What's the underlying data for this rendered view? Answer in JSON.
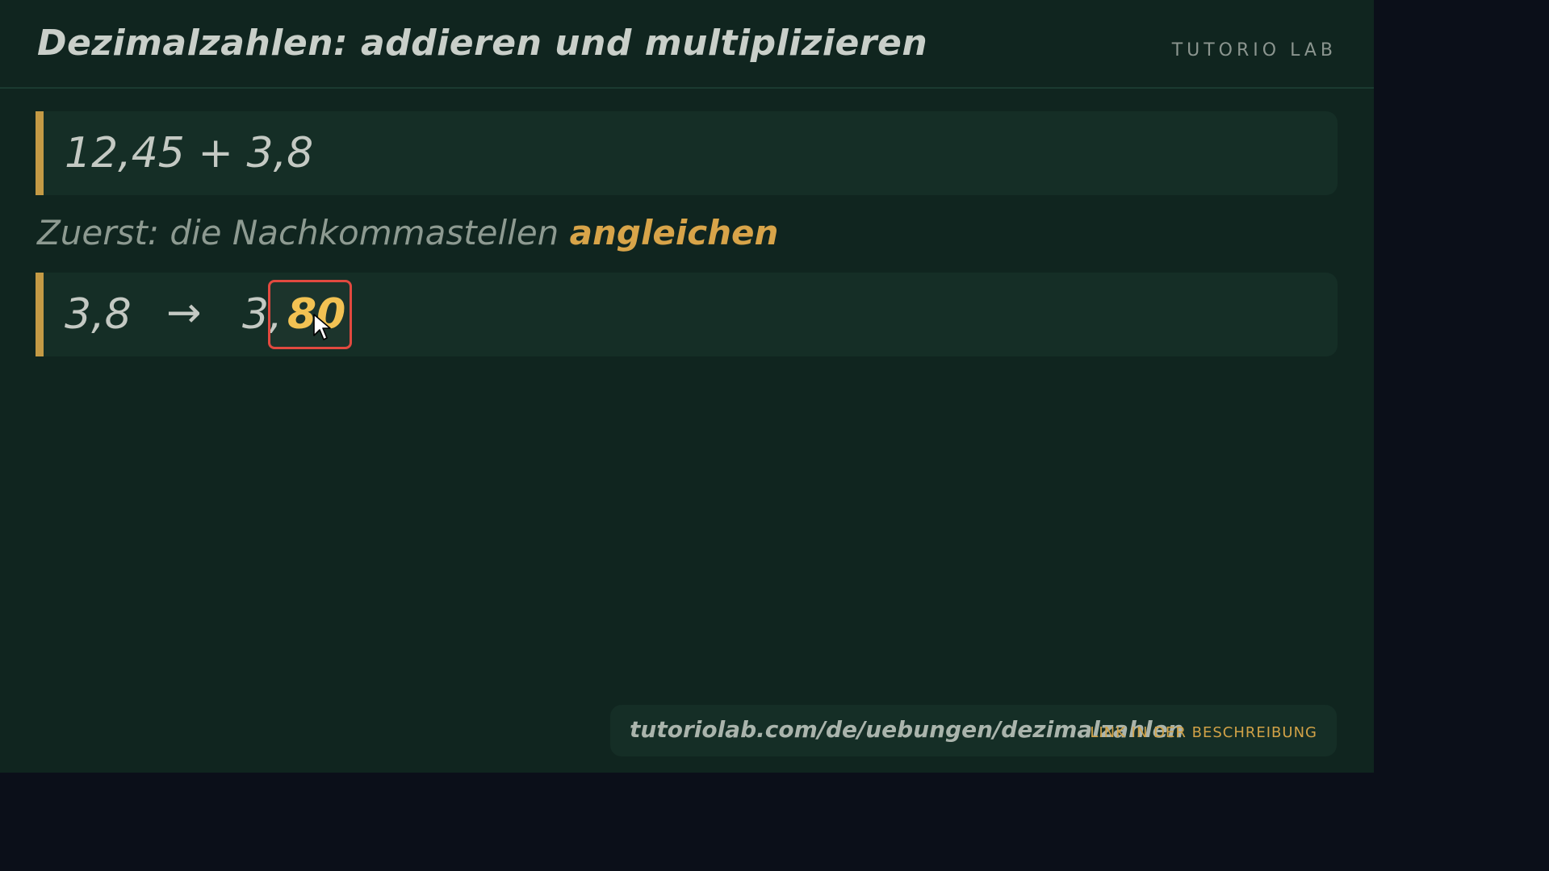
{
  "header": {
    "title": "Dezimalzahlen: addieren und multiplizieren",
    "brand": "TUTORIO LAB"
  },
  "problem": {
    "expression": "12,45 + 3,8"
  },
  "instruction": {
    "text": "Zuerst: die Nachkommastellen ",
    "highlight": "angleichen"
  },
  "step": {
    "before": "3,8",
    "arrow": "→",
    "after_integer": "3,",
    "after_digits": "80"
  },
  "footer": {
    "url": "tutoriolab.com/de/uebungen/dezimalzahlen",
    "note": "LINK IN DER BESCHREIBUNG"
  },
  "colors": {
    "background": "#10251f",
    "accent": "#c49a45",
    "highlight": "#f2c14e",
    "focus": "#e2493f"
  }
}
